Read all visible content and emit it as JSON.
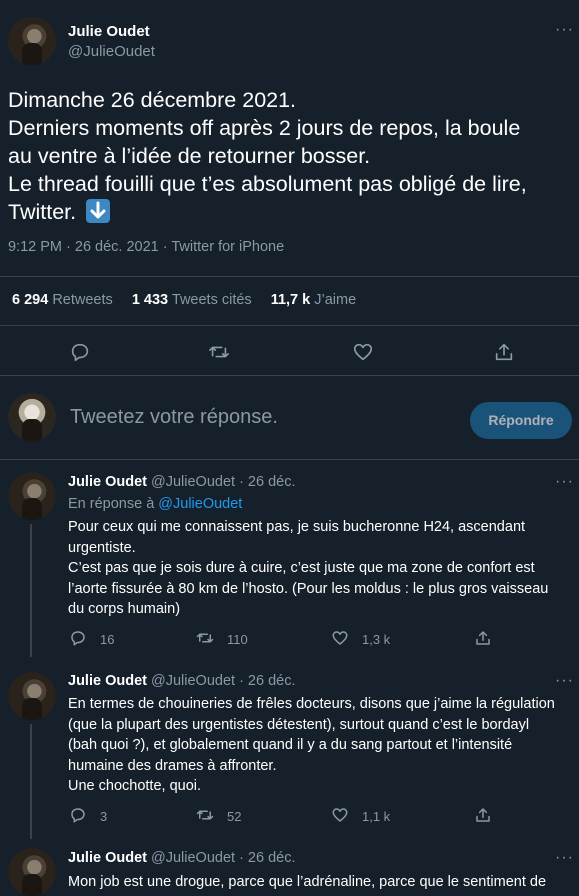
{
  "main_tweet": {
    "author_name": "Julie Oudet",
    "author_handle": "@JulieOudet",
    "text_lines": [
      "Dimanche 26 décembre 2021.",
      "Derniers moments off après 2 jours de repos, la boule",
      "au ventre à l’idée de retourner bosser.",
      "Le thread fouilli que t’es absolument pas obligé de lire,",
      "Twitter."
    ],
    "emoji_label": "⬇",
    "meta": "9:12 PM · 26 déc. 2021 · Twitter for iPhone",
    "stats": {
      "retweets_value": "6 294",
      "retweets_label": "Retweets",
      "quotes_value": "1 433",
      "quotes_label": "Tweets cités",
      "likes_value": "11,7 k",
      "likes_label": "J’aime"
    }
  },
  "compose": {
    "placeholder": "Tweetez votre réponse.",
    "button_label": "Répondre"
  },
  "replies": [
    {
      "name": "Julie Oudet",
      "handle_date": "@JulieOudet · 26 déc.",
      "in_reply_prefix": "En réponse à",
      "in_reply_handle": "@JulieOudet",
      "lines": [
        "Pour ceux qui me connaissent pas, je suis bucheronne H24, ascendant",
        "urgentiste.",
        "C’est pas que je sois dure à cuire, c’est juste que ma zone de confort est",
        "l’aorte fissurée à 80 km de l’hosto. (Pour les moldus : le plus gros vaisseau",
        "du corps humain)"
      ],
      "replies": "16",
      "retweets": "110",
      "likes": "1,3 k"
    },
    {
      "name": "Julie Oudet",
      "handle_date": "@JulieOudet · 26 déc.",
      "lines": [
        "En termes de chouineries de frêles docteurs, disons que j’aime la régulation",
        "(que la plupart des urgentistes détestent), surtout quand c’est le bordayl",
        "(bah quoi ?), et globalement quand il y a du sang partout et l’intensité",
        "humaine des drames à affronter.",
        "Une chochotte, quoi."
      ],
      "replies": "3",
      "retweets": "52",
      "likes": "1,1 k"
    },
    {
      "name": "Julie Oudet",
      "handle_date": "@JulieOudet · 26 déc.",
      "lines": [
        "Mon job est une drogue, parce que l’adrénaline, parce que le sentiment de"
      ]
    }
  ],
  "colors": {
    "background": "#15202b",
    "muted": "#8b98a5",
    "link": "#1d9bf0",
    "divider": "#38444d",
    "emoji_bg": "#3b88c3"
  },
  "icons": [
    "more-icon",
    "reply-icon",
    "retweet-icon",
    "like-icon",
    "share-icon",
    "arrow-down-emoji"
  ]
}
